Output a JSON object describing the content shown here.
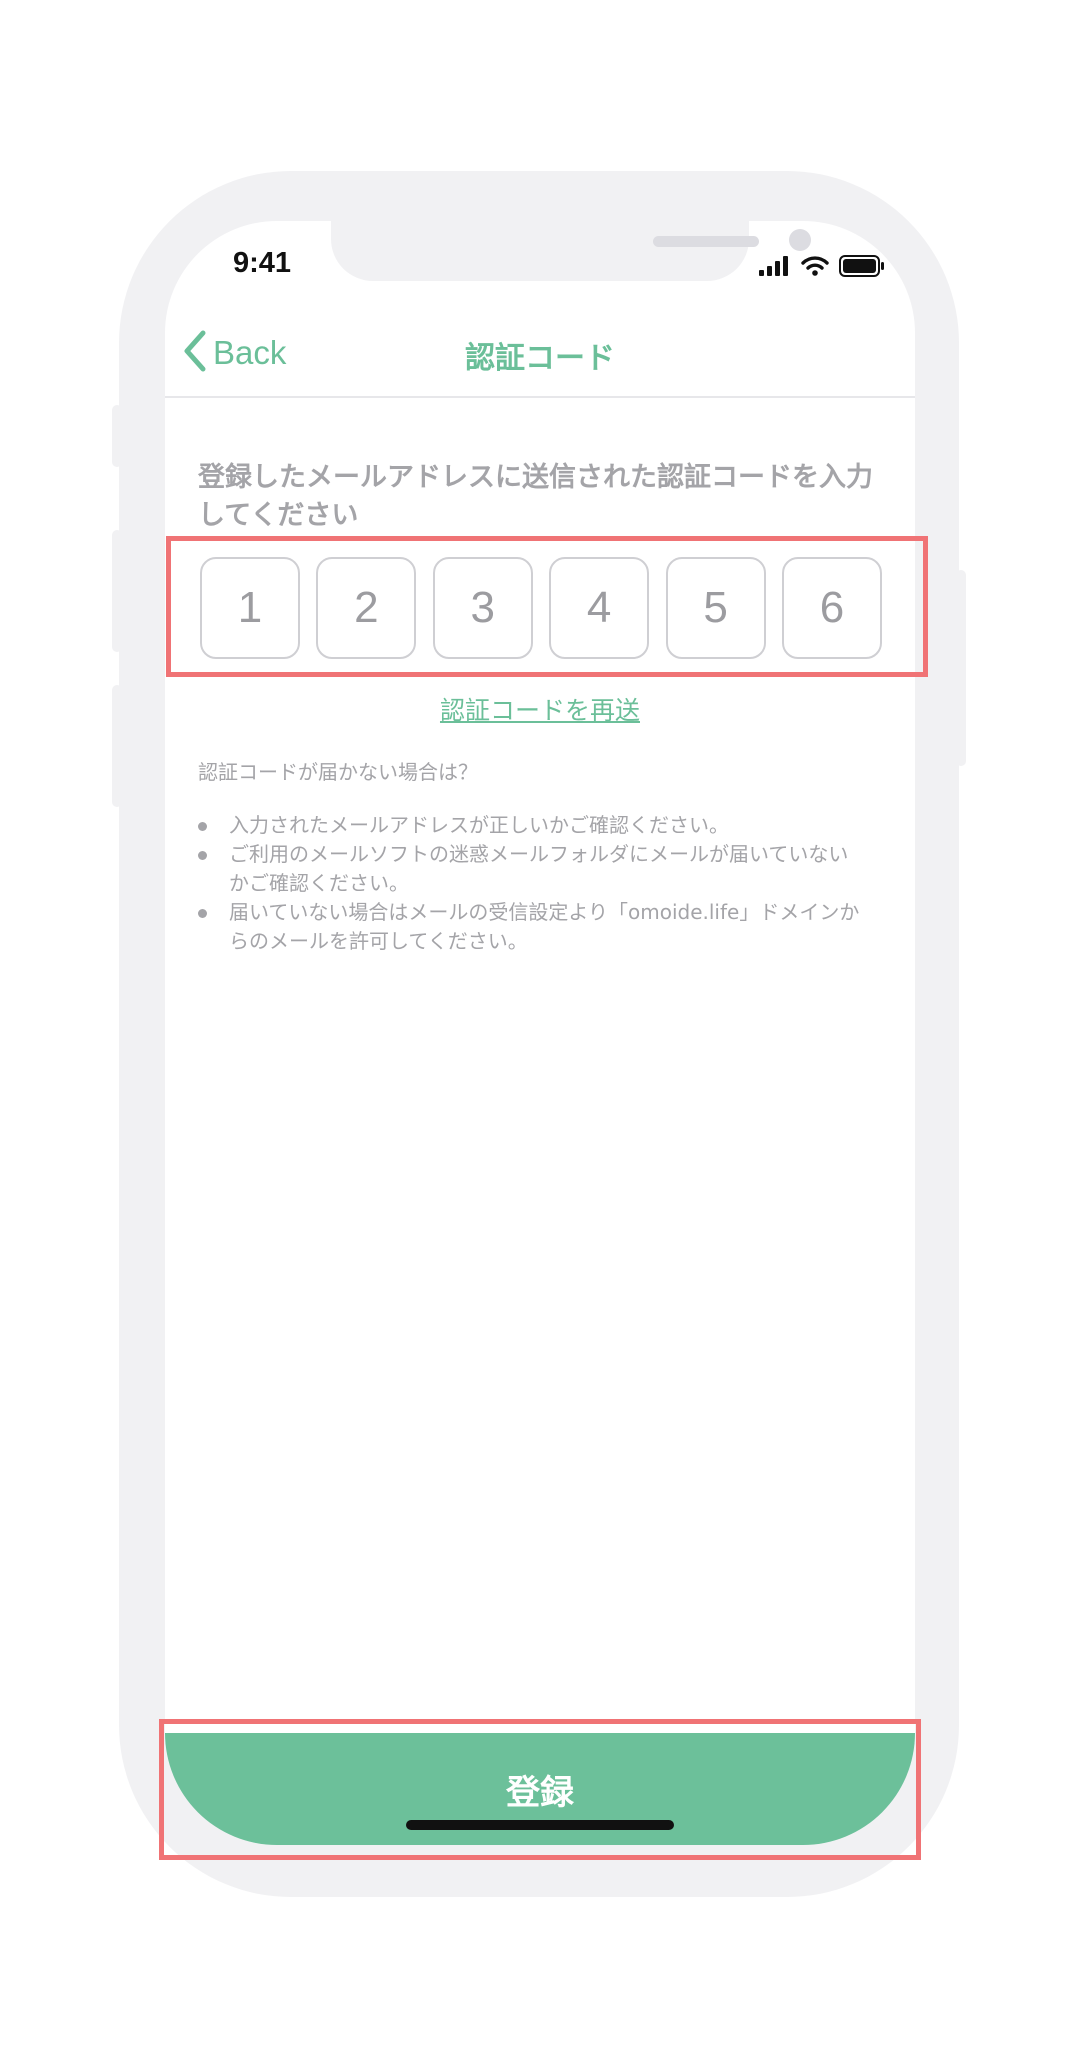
{
  "status_bar": {
    "time": "9:41"
  },
  "nav": {
    "back_label": "Back",
    "title": "認証コード"
  },
  "instruction": "登録したメールアドレスに送信された認証コードを入力してください",
  "code_digits": [
    "1",
    "2",
    "3",
    "4",
    "5",
    "6"
  ],
  "resend_link": "認証コードを再送",
  "help": {
    "title": "認証コードが届かない場合は？",
    "items": [
      "入力されたメールアドレスが正しいかご確認ください。",
      "ご利用のメールソフトの迷惑メールフォルダにメールが届いていないかご確認ください。",
      "届いていない場合はメールの受信設定より「omoide.life」ドメインからのメールを許可してください。"
    ]
  },
  "register_button": {
    "label": "登録"
  },
  "colors": {
    "accent": "#6bbf99",
    "highlight": "#f07375",
    "muted_text": "#a4a4a8",
    "frame": "#f1f1f3"
  },
  "icons": {
    "back": "chevron-left-icon",
    "signal": "cellular-signal-icon",
    "wifi": "wifi-icon",
    "battery": "battery-icon"
  }
}
